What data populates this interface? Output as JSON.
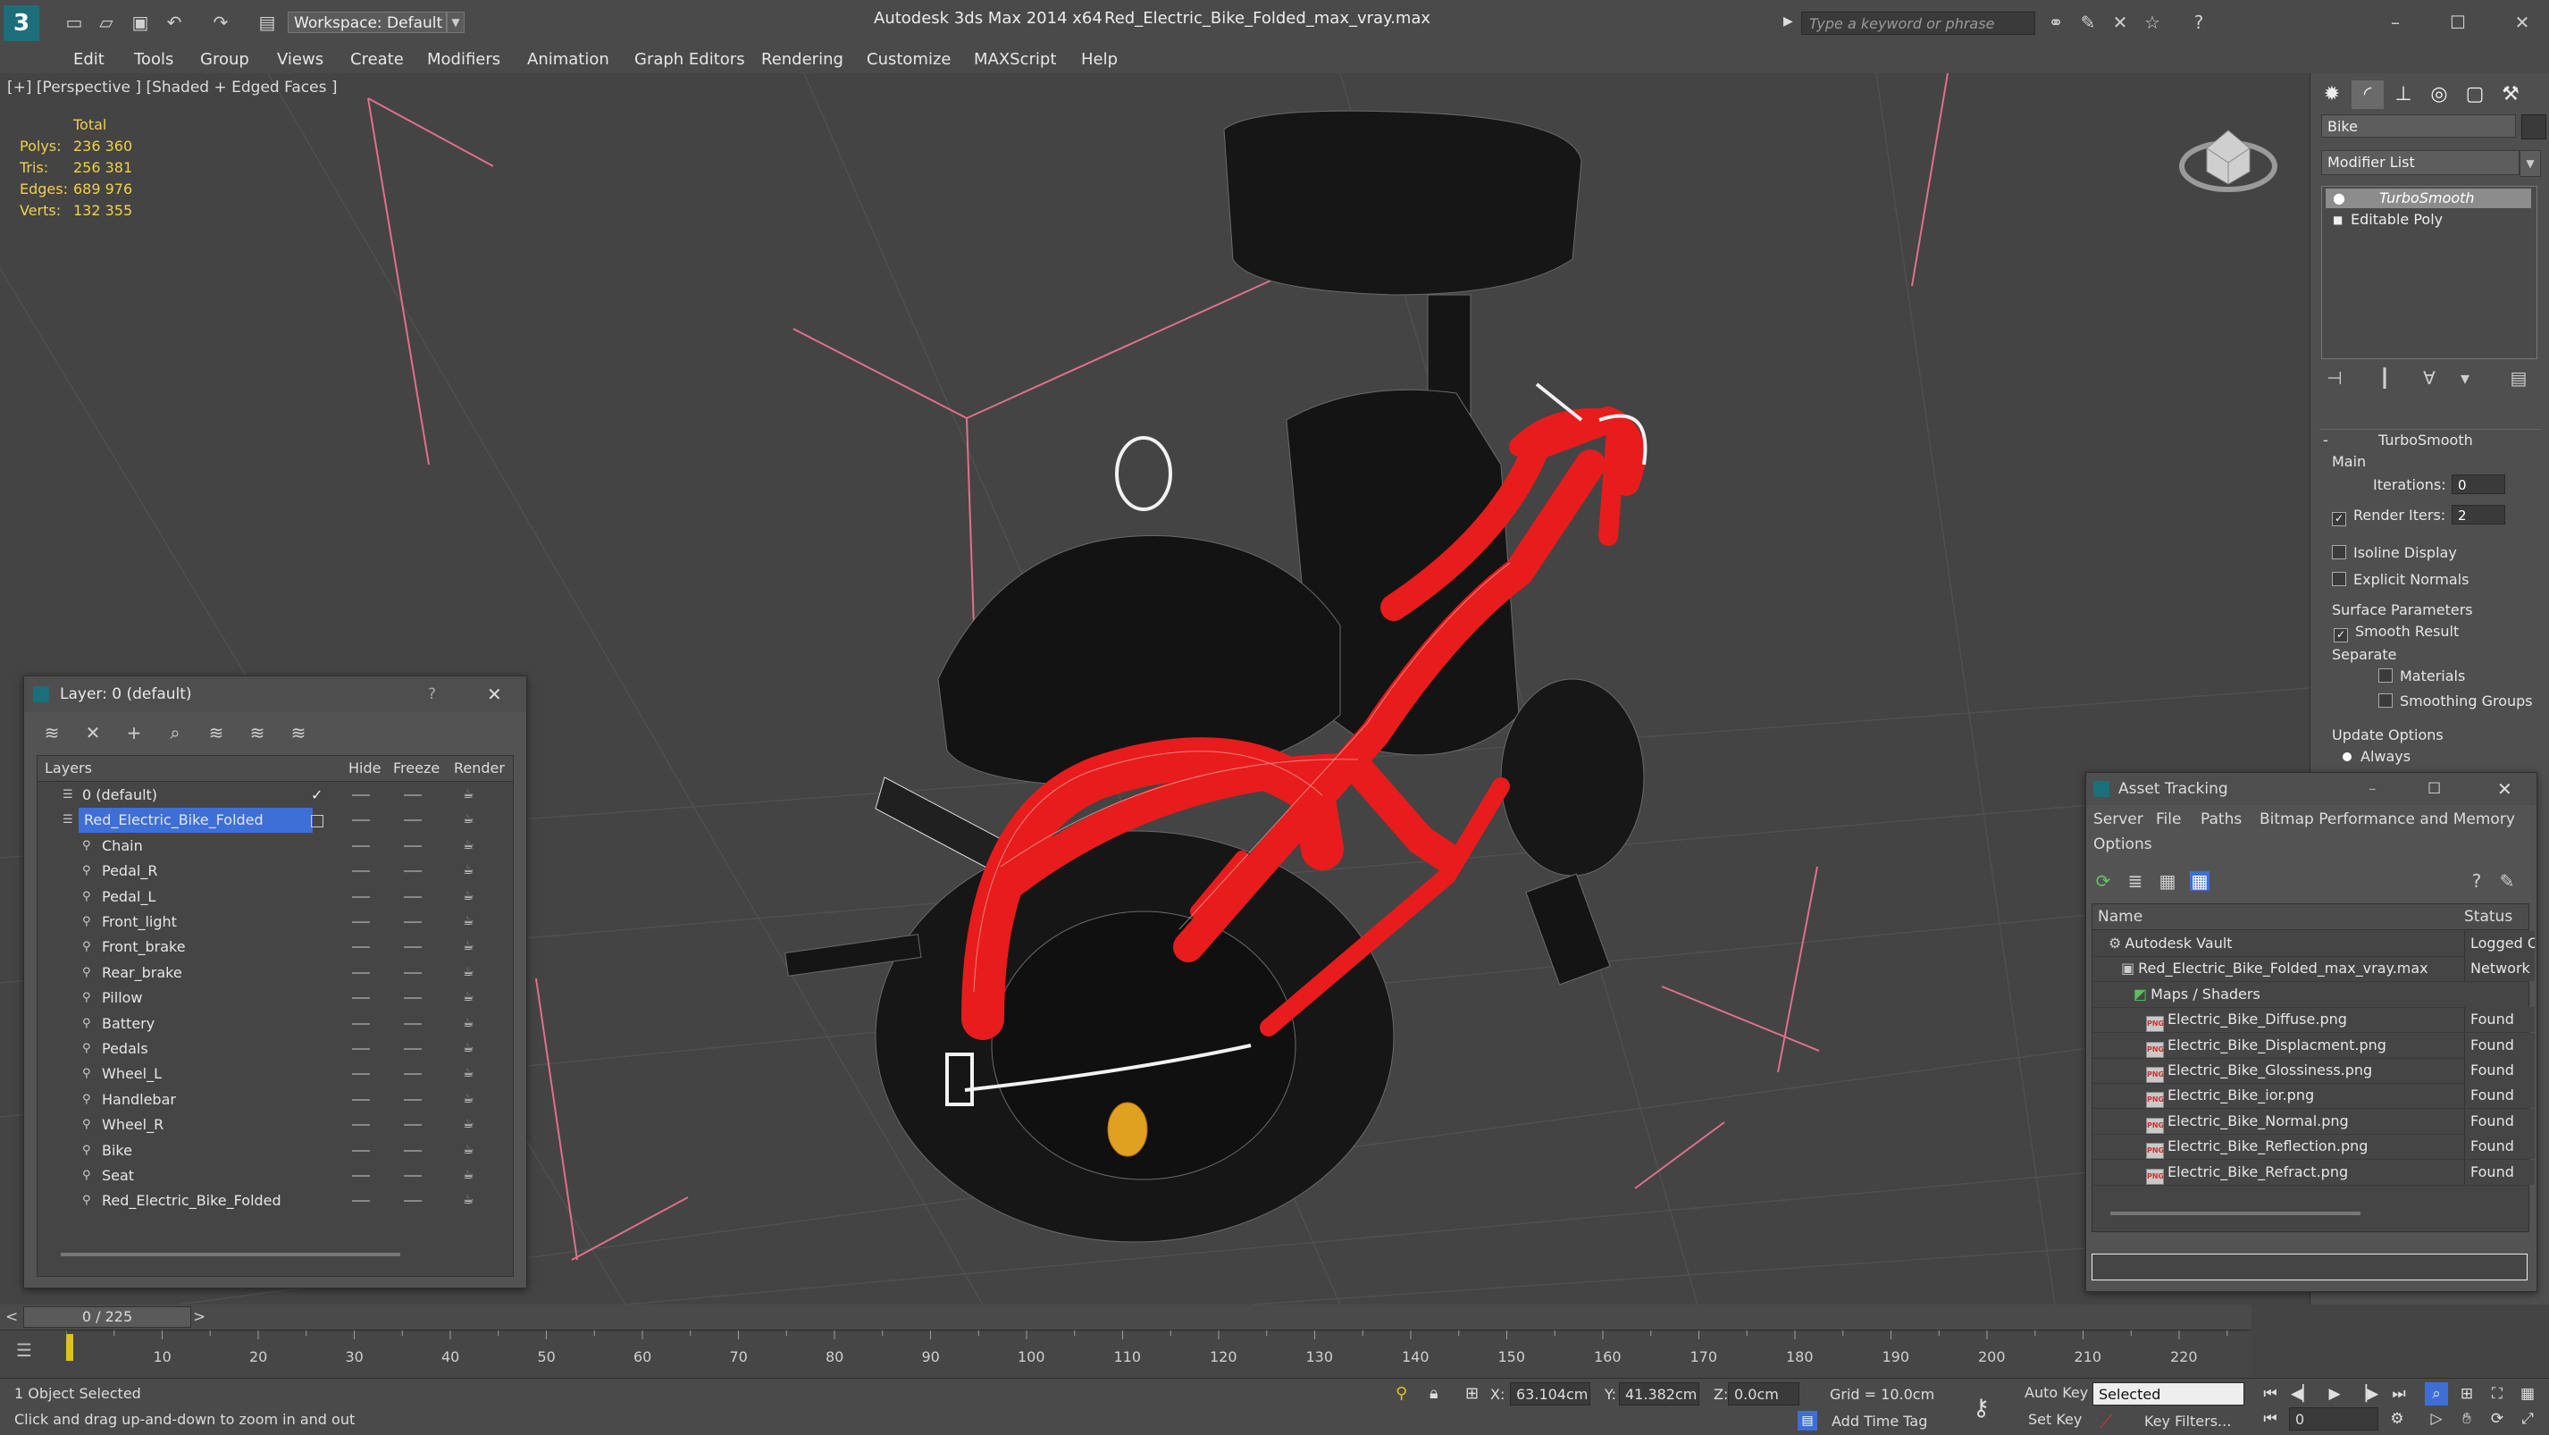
{
  "titlebar": {
    "app": "Autodesk 3ds Max  2014 x64",
    "filename": "Red_Electric_Bike_Folded_max_vray.max",
    "workspace": "Workspace: Default",
    "search_placeholder": "Type a keyword or phrase"
  },
  "menu": [
    "Edit",
    "Tools",
    "Group",
    "Views",
    "Create",
    "Modifiers",
    "Animation",
    "Graph Editors",
    "Rendering",
    "Customize",
    "MAXScript",
    "Help"
  ],
  "viewport": {
    "label": "[+] [Perspective ] [Shaded + Edged Faces ]",
    "stats": {
      "header": "Total",
      "rows": [
        {
          "label": "Polys:",
          "value": "236 360"
        },
        {
          "label": "Tris:",
          "value": "256 381"
        },
        {
          "label": "Edges:",
          "value": "689 976"
        },
        {
          "label": "Verts:",
          "value": "132 355"
        }
      ]
    }
  },
  "command_panel": {
    "object_name": "Bike",
    "modifier_list": "Modifier List",
    "stack": [
      "TurboSmooth",
      "Editable Poly"
    ],
    "rollout_title": "TurboSmooth",
    "main_label": "Main",
    "iterations_label": "Iterations:",
    "iterations_value": "0",
    "render_iters_label": "Render Iters:",
    "render_iters_value": "2",
    "isoline": "Isoline Display",
    "explicit_normals": "Explicit Normals",
    "surface_params": "Surface Parameters",
    "smooth_result": "Smooth Result",
    "separate": "Separate",
    "materials": "Materials",
    "smoothing_groups": "Smoothing Groups",
    "update_options": "Update Options",
    "always": "Always"
  },
  "layer_window": {
    "title": "Layer: 0 (default)",
    "help": "?",
    "columns": [
      "Layers",
      "Hide",
      "Freeze",
      "Render"
    ],
    "layers": [
      {
        "name": "0 (default)",
        "level": 0,
        "selected": false
      },
      {
        "name": "Red_Electric_Bike_Folded",
        "level": 0,
        "selected": true
      },
      {
        "name": "Chain",
        "level": 1,
        "selected": false
      },
      {
        "name": "Pedal_R",
        "level": 1,
        "selected": false
      },
      {
        "name": "Pedal_L",
        "level": 1,
        "selected": false
      },
      {
        "name": "Front_light",
        "level": 1,
        "selected": false
      },
      {
        "name": "Front_brake",
        "level": 1,
        "selected": false
      },
      {
        "name": "Rear_brake",
        "level": 1,
        "selected": false
      },
      {
        "name": "Pillow",
        "level": 1,
        "selected": false
      },
      {
        "name": "Battery",
        "level": 1,
        "selected": false
      },
      {
        "name": "Pedals",
        "level": 1,
        "selected": false
      },
      {
        "name": "Wheel_L",
        "level": 1,
        "selected": false
      },
      {
        "name": "Handlebar",
        "level": 1,
        "selected": false
      },
      {
        "name": "Wheel_R",
        "level": 1,
        "selected": false
      },
      {
        "name": "Bike",
        "level": 1,
        "selected": false
      },
      {
        "name": "Seat",
        "level": 1,
        "selected": false
      },
      {
        "name": "Red_Electric_Bike_Folded",
        "level": 1,
        "selected": false
      }
    ]
  },
  "asset_window": {
    "title": "Asset Tracking",
    "menu": [
      "Server",
      "File",
      "Paths",
      "Bitmap Performance and Memory",
      "Options"
    ],
    "columns": [
      "Name",
      "Status"
    ],
    "rows": [
      {
        "name": "Autodesk Vault",
        "status": "Logged C",
        "indent": 1,
        "icon": "vault"
      },
      {
        "name": "Red_Electric_Bike_Folded_max_vray.max",
        "status": "Network",
        "indent": 2,
        "icon": "max"
      },
      {
        "name": "Maps / Shaders",
        "status": "",
        "indent": 3,
        "icon": "maps"
      },
      {
        "name": "Electric_Bike_Diffuse.png",
        "status": "Found",
        "indent": 4,
        "icon": "png"
      },
      {
        "name": "Electric_Bike_Displacment.png",
        "status": "Found",
        "indent": 4,
        "icon": "png"
      },
      {
        "name": "Electric_Bike_Glossiness.png",
        "status": "Found",
        "indent": 4,
        "icon": "png"
      },
      {
        "name": "Electric_Bike_ior.png",
        "status": "Found",
        "indent": 4,
        "icon": "png"
      },
      {
        "name": "Electric_Bike_Normal.png",
        "status": "Found",
        "indent": 4,
        "icon": "png"
      },
      {
        "name": "Electric_Bike_Reflection.png",
        "status": "Found",
        "indent": 4,
        "icon": "png"
      },
      {
        "name": "Electric_Bike_Refract.png",
        "status": "Found",
        "indent": 4,
        "icon": "png"
      }
    ]
  },
  "timeline": {
    "frame": "0 / 225",
    "ticks": [
      "10",
      "20",
      "30",
      "40",
      "50",
      "60",
      "70",
      "80",
      "90",
      "100",
      "110",
      "120",
      "130",
      "140",
      "150",
      "160",
      "170",
      "180",
      "190",
      "200",
      "210",
      "220"
    ]
  },
  "status": {
    "selection": "1 Object Selected",
    "prompt": "Click and drag up-and-down to zoom in and out",
    "x_label": "X:",
    "x_value": "63.104cm",
    "y_label": "Y:",
    "y_value": "41.382cm",
    "z_label": "Z:",
    "z_value": "0.0cm",
    "grid": "Grid = 10.0cm",
    "add_time_tag": "Add Time Tag",
    "auto_key": "Auto Key",
    "set_key": "Set Key",
    "selected_dropdown": "Selected",
    "key_filters": "Key Filters...",
    "current_frame": "0"
  },
  "colors": {
    "wire_red": "#e81c1c",
    "stats_yellow": "#f0d04a",
    "selection_blue": "#3d6fd6",
    "bounding_pink": "#e0708a"
  }
}
